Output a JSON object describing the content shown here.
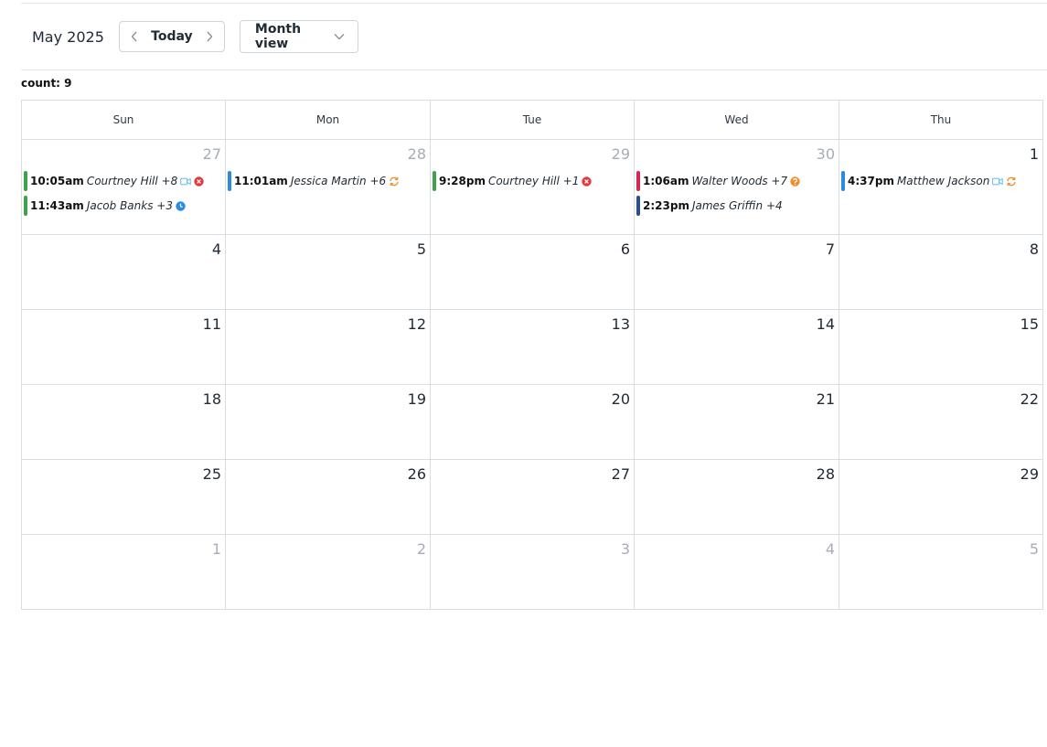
{
  "toolbar": {
    "month_title": "May 2025",
    "today_label": "Today",
    "view_label": "Month view"
  },
  "count_label": "count: 9",
  "weekdays": [
    "Sun",
    "Mon",
    "Tue",
    "Wed",
    "Thu"
  ],
  "weeks": [
    [
      {
        "day": "27",
        "muted": true,
        "events": [
          {
            "time": "10:05am",
            "title": "Courtney Hill +8",
            "color": "#3fa34d",
            "icons": [
              "video-icon",
              "cancelled-icon"
            ]
          },
          {
            "time": "11:43am",
            "title": "Jacob Banks +3",
            "color": "#3fa34d",
            "icons": [
              "clock-icon"
            ]
          }
        ]
      },
      {
        "day": "28",
        "muted": true,
        "events": [
          {
            "time": "11:01am",
            "title": "Jessica Martin +6",
            "color": "#2b8be0",
            "icons": [
              "recurring-icon"
            ]
          }
        ]
      },
      {
        "day": "29",
        "muted": true,
        "events": [
          {
            "time": "9:28pm",
            "title": "Courtney Hill +1",
            "color": "#3fa34d",
            "icons": [
              "cancelled-icon"
            ]
          }
        ]
      },
      {
        "day": "30",
        "muted": true,
        "events": [
          {
            "time": "1:06am",
            "title": "Walter Woods +7",
            "color": "#d7264f",
            "icons": [
              "question-icon"
            ]
          },
          {
            "time": "2:23pm",
            "title": "James Griffin +4",
            "color": "#2c4f8c",
            "icons": []
          }
        ]
      },
      {
        "day": "1",
        "muted": false,
        "events": [
          {
            "time": "4:37pm",
            "title": "Matthew Jackson",
            "color": "#2b8be0",
            "icons": [
              "video-icon",
              "recurring-icon"
            ]
          }
        ]
      }
    ],
    [
      {
        "day": "4",
        "muted": false,
        "events": []
      },
      {
        "day": "5",
        "muted": false,
        "events": []
      },
      {
        "day": "6",
        "muted": false,
        "events": []
      },
      {
        "day": "7",
        "muted": false,
        "events": []
      },
      {
        "day": "8",
        "muted": false,
        "events": []
      }
    ],
    [
      {
        "day": "11",
        "muted": false,
        "events": []
      },
      {
        "day": "12",
        "muted": false,
        "events": []
      },
      {
        "day": "13",
        "muted": false,
        "events": []
      },
      {
        "day": "14",
        "muted": false,
        "events": []
      },
      {
        "day": "15",
        "muted": false,
        "events": []
      }
    ],
    [
      {
        "day": "18",
        "muted": false,
        "events": []
      },
      {
        "day": "19",
        "muted": false,
        "events": []
      },
      {
        "day": "20",
        "muted": false,
        "events": []
      },
      {
        "day": "21",
        "muted": false,
        "events": []
      },
      {
        "day": "22",
        "muted": false,
        "events": []
      }
    ],
    [
      {
        "day": "25",
        "muted": false,
        "events": []
      },
      {
        "day": "26",
        "muted": false,
        "events": []
      },
      {
        "day": "27",
        "muted": false,
        "events": []
      },
      {
        "day": "28",
        "muted": false,
        "events": []
      },
      {
        "day": "29",
        "muted": false,
        "events": []
      }
    ],
    [
      {
        "day": "1",
        "muted": true,
        "events": []
      },
      {
        "day": "2",
        "muted": true,
        "events": []
      },
      {
        "day": "3",
        "muted": true,
        "events": []
      },
      {
        "day": "4",
        "muted": true,
        "events": []
      },
      {
        "day": "5",
        "muted": true,
        "events": []
      }
    ]
  ],
  "icon_colors": {
    "video-icon": "#6cc3f0",
    "cancelled-icon": "#e0393e",
    "clock-icon": "#2b8be0",
    "recurring-icon": "#f28c28",
    "question-icon": "#f28c28"
  }
}
